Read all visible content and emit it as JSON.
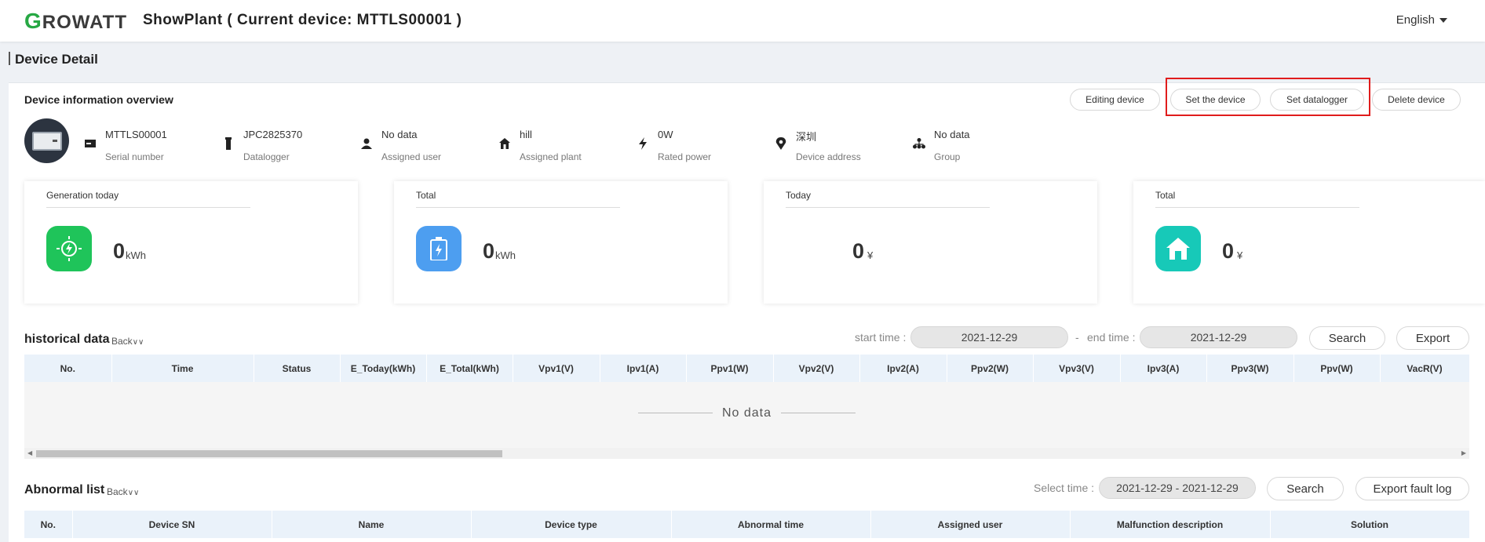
{
  "header": {
    "logo_text": "ROWATT",
    "logo_g": "G",
    "title": "ShowPlant ( Current device: MTTLS00001 )",
    "language": "English"
  },
  "page": {
    "title": "Device Detail"
  },
  "overview": {
    "title": "Device information overview",
    "buttons": {
      "edit": "Editing device",
      "set_device": "Set the device",
      "set_datalogger": "Set datalogger",
      "delete": "Delete device"
    },
    "items": [
      {
        "value": "MTTLS00001",
        "label": "Serial number",
        "icon": "serial-icon"
      },
      {
        "value": "JPC2825370",
        "label": "Datalogger",
        "icon": "datalogger-icon"
      },
      {
        "value": "No data",
        "label": "Assigned user",
        "icon": "user-icon"
      },
      {
        "value": "hill",
        "label": "Assigned plant",
        "icon": "plant-icon"
      },
      {
        "value": "0W",
        "label": "Rated power",
        "icon": "power-icon"
      },
      {
        "value": "深圳",
        "label": "Device address",
        "icon": "location-icon"
      },
      {
        "value": "No data",
        "label": "Group",
        "icon": "group-icon"
      }
    ]
  },
  "cards": [
    {
      "title": "Generation today",
      "value": "0",
      "unit": "kWh",
      "icon": "generation-icon",
      "color": "#1fc45a"
    },
    {
      "title": "Total",
      "value": "0",
      "unit": "kWh",
      "icon": "battery-icon",
      "color": "#4d9ef0"
    },
    {
      "title": "Today",
      "value": "0",
      "unit": "¥"
    },
    {
      "title": "Total",
      "value": "0",
      "unit": "¥",
      "icon": "house-icon",
      "color": "#17c9b8"
    }
  ],
  "historical": {
    "title": "historical data",
    "back": "Back",
    "start_label": "start time :",
    "start_value": "2021-12-29",
    "separator": "-",
    "end_label": "end time :",
    "end_value": "2021-12-29",
    "search": "Search",
    "export": "Export",
    "columns": [
      "No.",
      "Time",
      "Status",
      "E_Today(kWh)",
      "E_Total(kWh)",
      "Vpv1(V)",
      "Ipv1(A)",
      "Ppv1(W)",
      "Vpv2(V)",
      "Ipv2(A)",
      "Ppv2(W)",
      "Vpv3(V)",
      "Ipv3(A)",
      "Ppv3(W)",
      "Ppv(W)",
      "VacR(V)"
    ],
    "no_data": "No data"
  },
  "abnormal": {
    "title": "Abnormal list",
    "back": "Back",
    "select_label": "Select time :",
    "select_value": "2021-12-29 - 2021-12-29",
    "search": "Search",
    "export": "Export fault log",
    "columns": [
      "No.",
      "Device SN",
      "Name",
      "Device type",
      "Abnormal time",
      "Assigned user",
      "Malfunction description",
      "Solution"
    ]
  }
}
